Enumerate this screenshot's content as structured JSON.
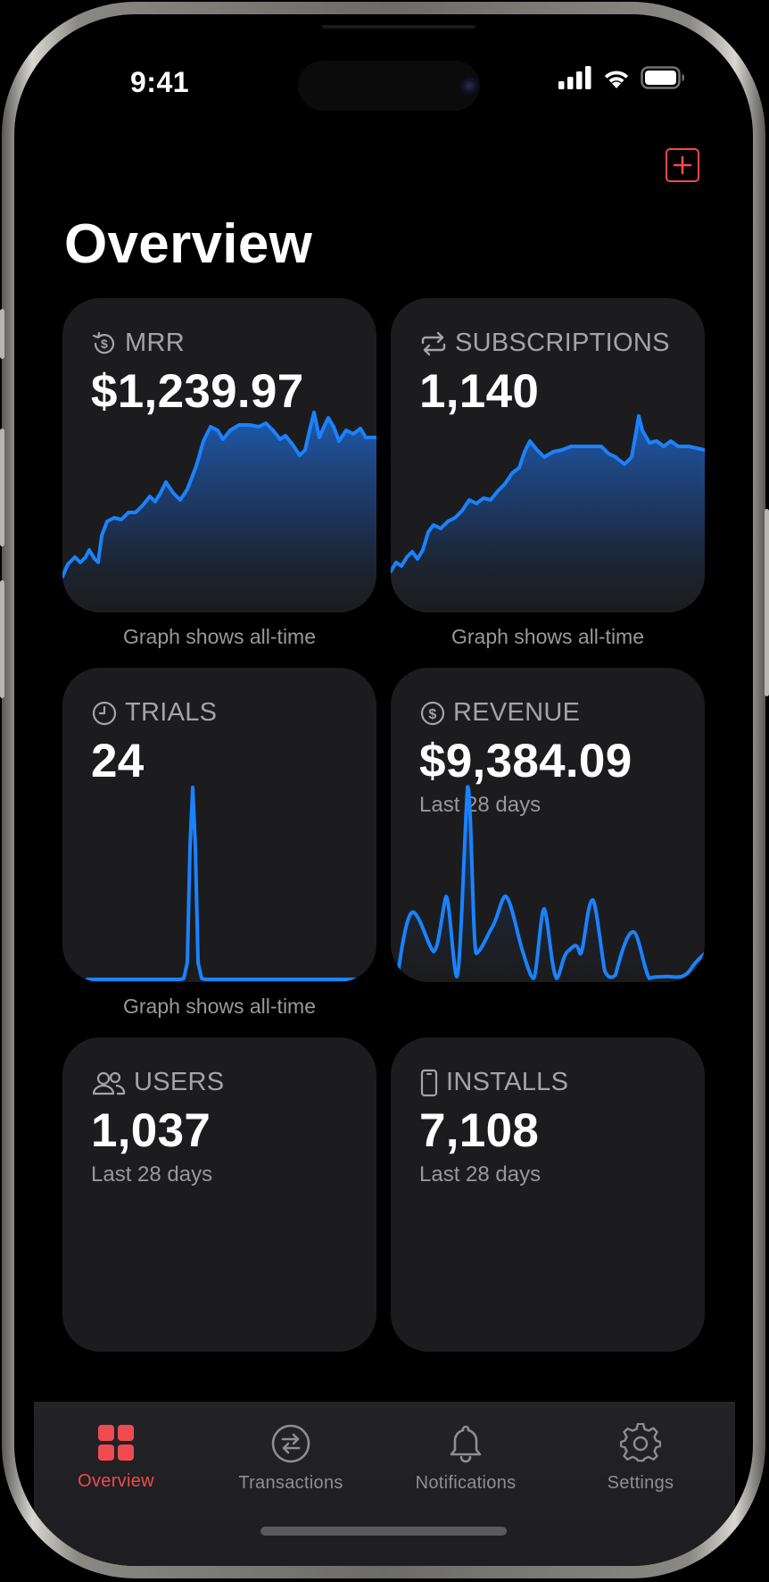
{
  "status_bar": {
    "time": "9:41",
    "icons": [
      "cellular-signal-icon",
      "wifi-icon",
      "battery-icon"
    ]
  },
  "header": {
    "title": "Overview",
    "add_icon": "plus-square-icon",
    "accent_color": "#ef4a4f"
  },
  "cards": {
    "mrr": {
      "label": "MRR",
      "icon": "dollar-refresh-icon",
      "value": "$1,239.97",
      "caption": "Graph shows all-time"
    },
    "subscriptions": {
      "label": "SUBSCRIPTIONS",
      "icon": "repeat-arrows-icon",
      "value": "1,140",
      "caption": "Graph shows all-time"
    },
    "trials": {
      "label": "TRIALS",
      "icon": "clock-icon",
      "value": "24",
      "caption": "Graph shows all-time"
    },
    "revenue": {
      "label": "REVENUE",
      "icon": "dollar-circle-icon",
      "value": "$9,384.09",
      "subtitle": "Last 28 days"
    },
    "users": {
      "label": "USERS",
      "icon": "users-icon",
      "value": "1,037",
      "subtitle": "Last 28 days"
    },
    "installs": {
      "label": "INSTALLS",
      "icon": "phone-icon",
      "value": "7,108",
      "subtitle": "Last 28 days"
    }
  },
  "chart_colors": {
    "line": "#1a82ff",
    "fill_top": "#1f5fb8",
    "fill_bottom": "#1c1c1e"
  },
  "tabbar": {
    "active_color": "#ef4a4f",
    "inactive_color": "#8e8e93",
    "tabs": [
      {
        "label": "Overview",
        "icon": "grid-icon",
        "active": true
      },
      {
        "label": "Transactions",
        "icon": "transactions-icon",
        "active": false
      },
      {
        "label": "Notifications",
        "icon": "bell-icon",
        "active": false
      },
      {
        "label": "Settings",
        "icon": "gear-icon",
        "active": false
      }
    ]
  }
}
